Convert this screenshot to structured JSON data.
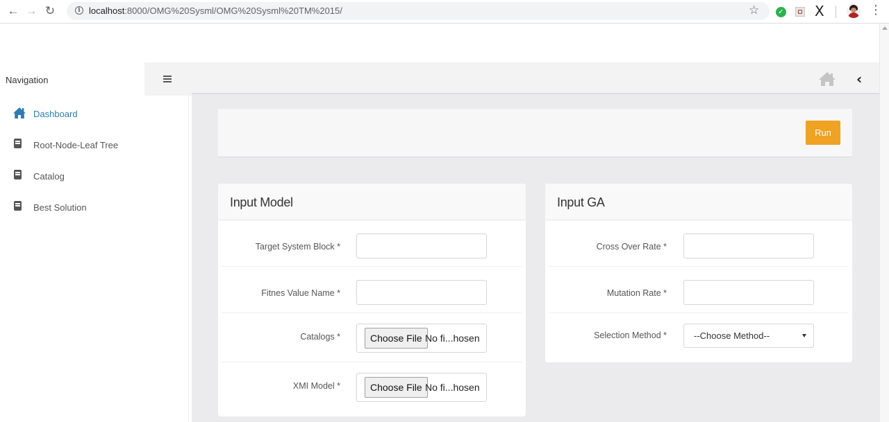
{
  "browser": {
    "url_host": "localhost",
    "url_path": ":8000/OMG%20Sysml/OMG%20Sysml%20TM%2015/"
  },
  "sidebar": {
    "title": "Navigation",
    "items": [
      {
        "label": "Dashboard",
        "icon": "home-icon",
        "active": true
      },
      {
        "label": "Root-Node-Leaf Tree",
        "icon": "book-icon",
        "active": false
      },
      {
        "label": "Catalog",
        "icon": "book-icon",
        "active": false
      },
      {
        "label": "Best Solution",
        "icon": "book-icon",
        "active": false
      }
    ]
  },
  "toolbar": {
    "run_label": "Run"
  },
  "input_model": {
    "title": "Input Model",
    "target_label": "Target System Block *",
    "target_value": "",
    "fitness_label": "Fitnes Value Name *",
    "fitness_value": "",
    "catalogs_label": "Catalogs *",
    "xmi_label": "XMI Model *",
    "file_button": "Choose File",
    "file_status": "No fi...hosen"
  },
  "input_ga": {
    "title": "Input GA",
    "crossover_label": "Cross Over Rate *",
    "crossover_value": "",
    "mutation_label": "Mutation Rate *",
    "mutation_value": "",
    "selection_label": "Selection Method *",
    "selection_value": "--Choose Method--"
  },
  "colors": {
    "accent": "#2b7cb9",
    "run_button": "#f0a222",
    "content_bg": "#ebebee"
  }
}
